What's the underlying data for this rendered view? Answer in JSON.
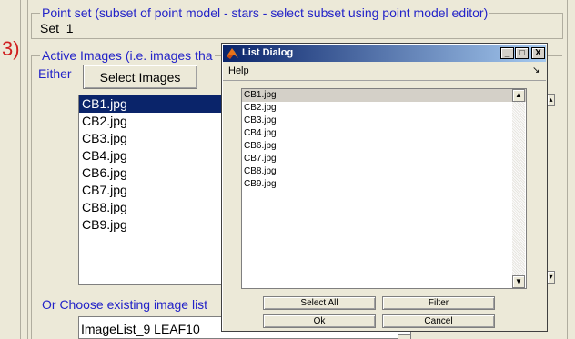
{
  "panel": {
    "point_set": {
      "title": "Point set (subset of point model - stars - select subset using point model editor)",
      "value": "Set_1"
    },
    "step_number": "3)",
    "active_images": {
      "title": "Active Images (i.e. images tha",
      "either_label": "Either",
      "select_images_label": "Select Images",
      "images": [
        "CB1.jpg",
        "CB2.jpg",
        "CB3.jpg",
        "CB4.jpg",
        "CB6.jpg",
        "CB7.jpg",
        "CB8.jpg",
        "CB9.jpg"
      ],
      "selected_index": 0,
      "choose_existing_label": "Or Choose existing image list",
      "existing_list_value": "ImageList_9  LEAF10"
    }
  },
  "dialog": {
    "title": "List Dialog",
    "menu": {
      "help": "Help"
    },
    "title_buttons": {
      "minimize": "_",
      "maximize": "□",
      "close": "X"
    },
    "items": [
      "CB1.jpg",
      "CB2.jpg",
      "CB3.jpg",
      "CB4.jpg",
      "CB6.jpg",
      "CB7.jpg",
      "CB8.jpg",
      "CB9.jpg"
    ],
    "buttons": {
      "select_all": "Select All",
      "filter": "Filter",
      "ok": "Ok",
      "cancel": "Cancel"
    }
  },
  "colors": {
    "title_bar_start": "#0a246a",
    "title_bar_end": "#a6caf0",
    "group_title_text": "#2323c8",
    "step_number_text": "#d02020",
    "selection": "#0a246a"
  }
}
